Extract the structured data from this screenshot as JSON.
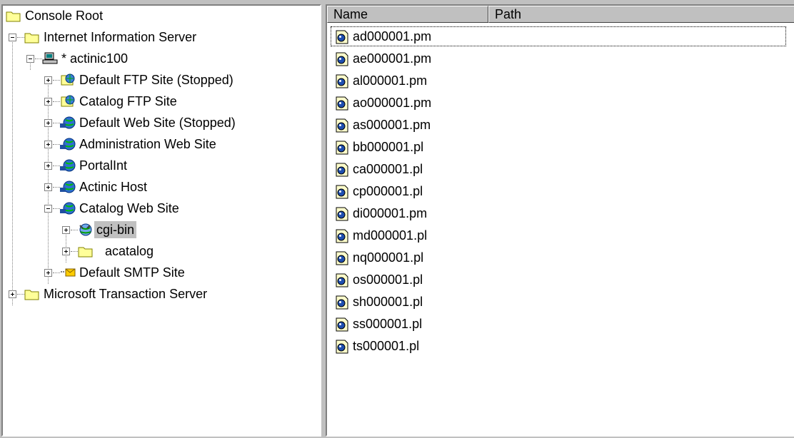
{
  "tree": {
    "nodes": [
      {
        "label": "Console Root",
        "icon": "folder-icon"
      },
      {
        "label": "Internet Information Server",
        "icon": "folder-icon"
      },
      {
        "label": "* actinic100",
        "icon": "computer-icon"
      },
      {
        "label": "Default FTP Site (Stopped)",
        "icon": "ftp-site-icon"
      },
      {
        "label": "Catalog FTP Site",
        "icon": "ftp-site-icon"
      },
      {
        "label": "Default Web Site (Stopped)",
        "icon": "web-site-icon"
      },
      {
        "label": "Administration Web Site",
        "icon": "web-site-icon"
      },
      {
        "label": "PortalInt",
        "icon": "web-site-icon"
      },
      {
        "label": "Actinic Host",
        "icon": "web-site-icon"
      },
      {
        "label": "Catalog Web Site",
        "icon": "web-site-icon"
      },
      {
        "label": "cgi-bin",
        "icon": "virtual-directory-icon",
        "selected": true
      },
      {
        "label": "acatalog",
        "icon": "folder-icon"
      },
      {
        "label": "Default SMTP Site",
        "icon": "smtp-site-icon"
      },
      {
        "label": "Microsoft Transaction Server",
        "icon": "folder-icon"
      }
    ]
  },
  "list": {
    "columns": [
      "Name",
      "Path"
    ],
    "files": [
      "ad000001.pm",
      "ae000001.pm",
      "al000001.pm",
      "ao000001.pm",
      "as000001.pm",
      "bb000001.pl",
      "ca000001.pl",
      "cp000001.pl",
      "di000001.pm",
      "md000001.pl",
      "nq000001.pl",
      "os000001.pl",
      "sh000001.pl",
      "ss000001.pl",
      "ts000001.pl"
    ],
    "file_icon": "script-file-icon"
  },
  "colors": {
    "background": "#c0c0c0",
    "folder": "#ffff99",
    "selection": "#c0c0c0"
  }
}
